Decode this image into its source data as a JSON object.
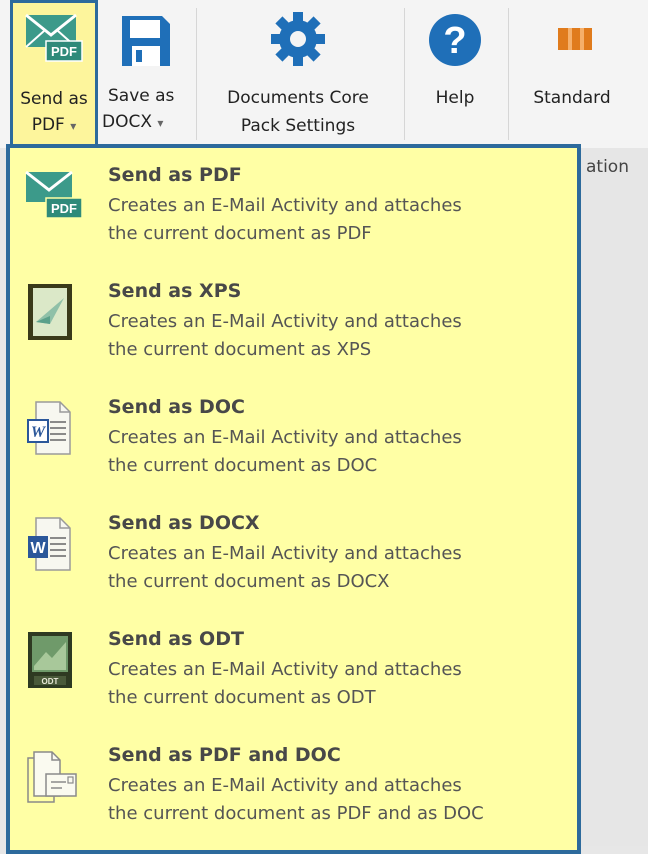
{
  "ribbon": {
    "send_pdf": {
      "line1": "Send as",
      "line2": "PDF",
      "caret": "▾"
    },
    "save_docx": {
      "line1": "Save as",
      "line2": "DOCX",
      "caret": "▾"
    },
    "settings": {
      "line1": "Documents Core",
      "line2": "Pack Settings"
    },
    "help": {
      "label": "Help",
      "glyph": "?"
    },
    "standard": {
      "label": "Standard"
    },
    "group_label": "ation"
  },
  "menu": {
    "items": [
      {
        "title": "Send as PDF",
        "desc1": "Creates an E-Mail Activity and attaches",
        "desc2": "the current document as PDF",
        "icon": "envelope-pdf-icon",
        "badge": "PDF"
      },
      {
        "title": "Send as XPS",
        "desc1": "Creates an E-Mail Activity and attaches",
        "desc2": "the current document as XPS",
        "icon": "xps-document-icon"
      },
      {
        "title": "Send as DOC",
        "desc1": "Creates an E-Mail Activity and attaches",
        "desc2": "the current document as DOC",
        "icon": "word-doc-icon",
        "badge": "W"
      },
      {
        "title": "Send as DOCX",
        "desc1": "Creates an E-Mail Activity and attaches",
        "desc2": "the current document as DOCX",
        "icon": "word-docx-icon",
        "badge": "W"
      },
      {
        "title": "Send as ODT",
        "desc1": "Creates an E-Mail Activity and attaches",
        "desc2": "the current document as ODT",
        "icon": "odt-document-icon",
        "badge": "ODT"
      },
      {
        "title": "Send as PDF and DOC",
        "desc1": "Creates an E-Mail Activity and attaches",
        "desc2": "the current document as PDF and as DOC",
        "icon": "documents-email-icon"
      }
    ]
  },
  "colors": {
    "accent_border": "#2d6a9c",
    "menu_bg": "#ffffa5",
    "envelope_green": "#3c9a8a",
    "gear_blue": "#1f6fb8"
  }
}
